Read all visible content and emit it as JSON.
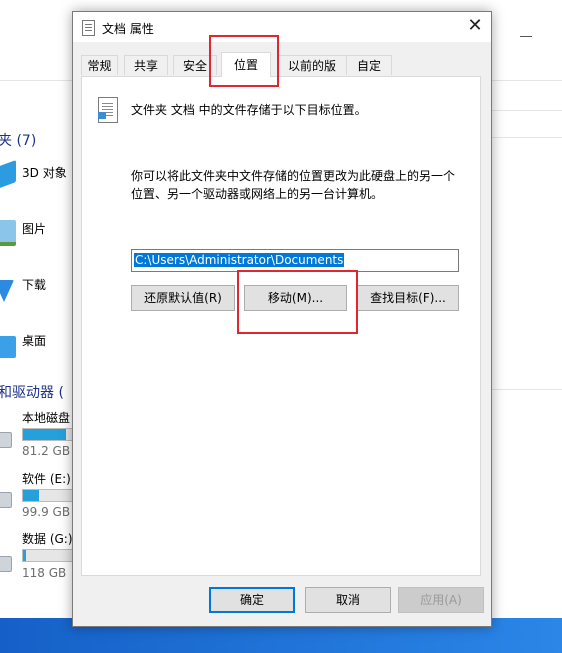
{
  "background": {
    "section_folders": "夹 (7)",
    "folders": [
      {
        "label": "3D 对象",
        "color": "#2c9be0"
      },
      {
        "label": "图片",
        "color": "#f3c969"
      },
      {
        "label": "下载",
        "color": "#2c8ae0"
      },
      {
        "label": "桌面",
        "color": "#3aa0e8"
      }
    ],
    "section_drives": "和驱动器 (",
    "drives": [
      {
        "label": "本地磁盘",
        "free": "81.2 GB",
        "used_fraction": 0.82
      },
      {
        "label": "软件 (E:)",
        "free": "99.9 GB",
        "used_fraction": 0.3
      },
      {
        "label": "数据 (G:)",
        "free": "118 GB",
        "used_fraction": 0.05
      }
    ]
  },
  "dialog": {
    "title": "文档 属性",
    "close_glyph": "✕",
    "tabs": [
      "常规",
      "共享",
      "安全",
      "位置",
      "以前的版本",
      "自定义"
    ],
    "active_tab": "位置",
    "description": "文件夹 文档 中的文件存储于以下目标位置。",
    "info_line1": "你可以将此文件夹中文件存储的位置更改为此硬盘上的另一个",
    "info_line2": "位置、另一个驱动器或网络上的另一台计算机。",
    "path_value": "C:\\Users\\Administrator\\Documents",
    "buttons": {
      "restore": "还原默认值(R)",
      "move": "移动(M)...",
      "find": "查找目标(F)..."
    },
    "footer": {
      "ok": "确定",
      "cancel": "取消",
      "apply": "应用(A)"
    },
    "highlight_color": "#e0262e"
  }
}
